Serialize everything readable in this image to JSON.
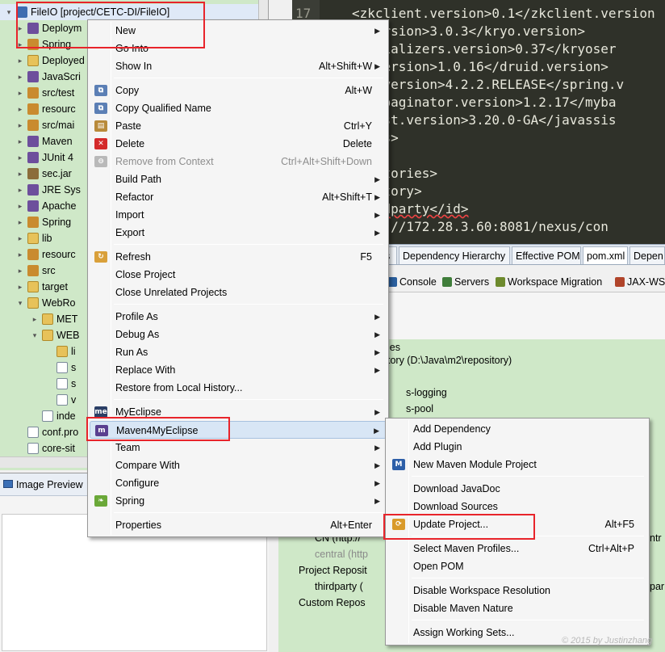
{
  "explorer": {
    "rows": [
      {
        "label": "FileIO [project/CETC-DI/FileIO]",
        "icon": "project-icon",
        "kind": "project",
        "arrow": "▾"
      },
      {
        "label": "Deploym",
        "icon": "deployment-icon",
        "kind": "lib",
        "arrow": "▸"
      },
      {
        "label": "Spring",
        "icon": "spring-icon",
        "kind": "src",
        "arrow": "▸"
      },
      {
        "label": "Deployed",
        "icon": "deployed-icon",
        "kind": "folder",
        "arrow": "▸"
      },
      {
        "label": "JavaScri",
        "icon": "library-icon",
        "kind": "lib",
        "arrow": "▸"
      },
      {
        "label": "src/test",
        "icon": "source-folder-icon",
        "kind": "src",
        "arrow": "▸"
      },
      {
        "label": "resourc",
        "icon": "source-folder-icon",
        "kind": "src",
        "arrow": "▸"
      },
      {
        "label": "src/mai",
        "icon": "source-folder-icon",
        "kind": "src",
        "arrow": "▸"
      },
      {
        "label": "Maven",
        "icon": "library-icon",
        "kind": "lib",
        "arrow": "▸"
      },
      {
        "label": "JUnit 4",
        "icon": "library-icon",
        "kind": "lib",
        "arrow": "▸"
      },
      {
        "label": "sec.jar",
        "icon": "jar-icon",
        "kind": "jar",
        "arrow": "▸"
      },
      {
        "label": "JRE Sys",
        "icon": "library-icon",
        "kind": "lib",
        "arrow": "▸"
      },
      {
        "label": "Apache",
        "icon": "library-icon",
        "kind": "lib",
        "arrow": "▸"
      },
      {
        "label": "Spring",
        "icon": "spring-icon",
        "kind": "src",
        "arrow": "▸"
      },
      {
        "label": "lib",
        "icon": "folder-icon",
        "kind": "folder",
        "arrow": "▸"
      },
      {
        "label": "resourc",
        "icon": "source-folder-icon",
        "kind": "src",
        "arrow": "▸"
      },
      {
        "label": "src",
        "icon": "source-folder-icon",
        "kind": "src",
        "arrow": "▸"
      },
      {
        "label": "target",
        "icon": "folder-icon",
        "kind": "folder",
        "arrow": "▸"
      },
      {
        "label": "WebRo",
        "icon": "folder-icon",
        "kind": "folder",
        "arrow": "▾"
      },
      {
        "label": "MET",
        "icon": "folder-icon",
        "kind": "folder",
        "arrow": "▸"
      },
      {
        "label": "WEB",
        "icon": "folder-icon",
        "kind": "folder",
        "arrow": "▾"
      },
      {
        "label": "li",
        "icon": "folder-icon",
        "kind": "folder",
        "arrow": ""
      },
      {
        "label": "s",
        "icon": "file-icon",
        "kind": "file",
        "arrow": ""
      },
      {
        "label": "s",
        "icon": "file-icon",
        "kind": "file",
        "arrow": ""
      },
      {
        "label": "v",
        "icon": "file-icon",
        "kind": "file",
        "arrow": ""
      },
      {
        "label": "inde",
        "icon": "file-icon",
        "kind": "file",
        "arrow": ""
      },
      {
        "label": "conf.pro",
        "icon": "file-icon",
        "kind": "file",
        "arrow": ""
      },
      {
        "label": "core-sit",
        "icon": "file-icon",
        "kind": "file",
        "arrow": ""
      }
    ]
  },
  "preview": {
    "title": "Image Preview"
  },
  "editor": {
    "line_number": "17",
    "lines": [
      "<zkclient.version>0.1</zkclient.version",
      "o.version>3.0.3</kryo.version>",
      "oserializers.version>0.37</kryoser",
      "id.version>1.0.16</druid.version>",
      "ing.version>4.2.2.RELEASE</spring.v",
      "atispaginator.version>1.2.17</myba",
      "assist.version>3.20.0-GA</javassis",
      "rties>",
      "",
      "positories>",
      "pository>",
      "thirdparty</id>",
      "http://172.28.3.60:8081/nexus/con"
    ]
  },
  "editor_tabs": [
    "s",
    "Dependency Hierarchy",
    "Effective POM",
    "pom.xml",
    "Depen"
  ],
  "console_tabs": [
    {
      "label": "Console",
      "icon": "console-icon"
    },
    {
      "label": "Servers",
      "icon": "servers-icon"
    },
    {
      "label": "Workspace Migration",
      "icon": "migration-icon"
    },
    {
      "label": "JAX-WS",
      "icon": "jaxws-icon"
    }
  ],
  "repo_view": {
    "rows": [
      {
        "label": "ies",
        "dim": false
      },
      {
        "label": "tory (D:\\Java\\m2\\repository)",
        "dim": false
      },
      {
        "label": "s-logging",
        "dim": false
      },
      {
        "label": "s-pool",
        "dim": false
      },
      {
        "label": "CN (http://",
        "dim": false
      },
      {
        "label": "central (http",
        "dim": true
      },
      {
        "label": "Project Reposit",
        "dim": false
      },
      {
        "label": "thirdparty (",
        "dim": false
      },
      {
        "label": "Custom Repos",
        "dim": false
      },
      {
        "label": "ntr",
        "dim": false
      },
      {
        "label": "par",
        "dim": false
      }
    ]
  },
  "context_menu": {
    "items": [
      {
        "label": "New",
        "shortcut": "",
        "submenu": true,
        "icon": ""
      },
      {
        "label": "Go Into",
        "shortcut": "",
        "submenu": false,
        "icon": ""
      },
      {
        "label": "Show In",
        "shortcut": "Alt+Shift+W",
        "submenu": true,
        "icon": ""
      },
      {
        "sep": true
      },
      {
        "label": "Copy",
        "shortcut": "Alt+W",
        "submenu": false,
        "icon": "copy-icon"
      },
      {
        "label": "Copy Qualified Name",
        "shortcut": "",
        "submenu": false,
        "icon": "copy-qualified-icon"
      },
      {
        "label": "Paste",
        "shortcut": "Ctrl+Y",
        "submenu": false,
        "icon": "paste-icon"
      },
      {
        "label": "Delete",
        "shortcut": "Delete",
        "submenu": false,
        "icon": "delete-icon"
      },
      {
        "label": "Remove from Context",
        "shortcut": "Ctrl+Alt+Shift+Down",
        "submenu": false,
        "icon": "remove-context-icon",
        "disabled": true
      },
      {
        "label": "Build Path",
        "shortcut": "",
        "submenu": true,
        "icon": ""
      },
      {
        "label": "Refactor",
        "shortcut": "Alt+Shift+T",
        "submenu": true,
        "icon": ""
      },
      {
        "label": "Import",
        "shortcut": "",
        "submenu": true,
        "icon": ""
      },
      {
        "label": "Export",
        "shortcut": "",
        "submenu": true,
        "icon": ""
      },
      {
        "sep": true
      },
      {
        "label": "Refresh",
        "shortcut": "F5",
        "submenu": false,
        "icon": "refresh-icon"
      },
      {
        "label": "Close Project",
        "shortcut": "",
        "submenu": false,
        "icon": ""
      },
      {
        "label": "Close Unrelated Projects",
        "shortcut": "",
        "submenu": false,
        "icon": ""
      },
      {
        "sep": true
      },
      {
        "label": "Profile As",
        "shortcut": "",
        "submenu": true,
        "icon": ""
      },
      {
        "label": "Debug As",
        "shortcut": "",
        "submenu": true,
        "icon": ""
      },
      {
        "label": "Run As",
        "shortcut": "",
        "submenu": true,
        "icon": ""
      },
      {
        "label": "Replace With",
        "shortcut": "",
        "submenu": true,
        "icon": ""
      },
      {
        "label": "Restore from Local History...",
        "shortcut": "",
        "submenu": false,
        "icon": ""
      },
      {
        "sep": true
      },
      {
        "label": "MyEclipse",
        "shortcut": "",
        "submenu": true,
        "icon": "myeclipse-icon"
      },
      {
        "label": "Maven4MyEclipse",
        "shortcut": "",
        "submenu": true,
        "icon": "maven4myeclipse-icon",
        "hover": true
      },
      {
        "label": "Team",
        "shortcut": "",
        "submenu": true,
        "icon": ""
      },
      {
        "label": "Compare With",
        "shortcut": "",
        "submenu": true,
        "icon": ""
      },
      {
        "label": "Configure",
        "shortcut": "",
        "submenu": true,
        "icon": ""
      },
      {
        "label": "Spring",
        "shortcut": "",
        "submenu": true,
        "icon": "spring-leaf-icon"
      },
      {
        "sep": true
      },
      {
        "label": "Properties",
        "shortcut": "Alt+Enter",
        "submenu": false,
        "icon": ""
      }
    ]
  },
  "maven_submenu": {
    "items": [
      {
        "label": "Add Dependency",
        "shortcut": "",
        "icon": ""
      },
      {
        "label": "Add Plugin",
        "shortcut": "",
        "icon": ""
      },
      {
        "label": "New Maven Module Project",
        "shortcut": "",
        "icon": "maven-module-icon"
      },
      {
        "sep": true
      },
      {
        "label": "Download JavaDoc",
        "shortcut": "",
        "icon": ""
      },
      {
        "label": "Download Sources",
        "shortcut": "",
        "icon": ""
      },
      {
        "label": "Update Project...",
        "shortcut": "Alt+F5",
        "icon": "update-project-icon"
      },
      {
        "sep": true
      },
      {
        "label": "Select Maven Profiles...",
        "shortcut": "Ctrl+Alt+P",
        "icon": ""
      },
      {
        "label": "Open POM",
        "shortcut": "",
        "icon": ""
      },
      {
        "sep": true
      },
      {
        "label": "Disable Workspace Resolution",
        "shortcut": "",
        "icon": ""
      },
      {
        "label": "Disable Maven Nature",
        "shortcut": "",
        "icon": ""
      },
      {
        "sep": true
      },
      {
        "label": "Assign Working Sets...",
        "shortcut": "",
        "icon": ""
      }
    ]
  },
  "watermark": "© 2015  by  Justinzhang",
  "colors": {
    "highlight": "#e8242b",
    "hover": "#d8e6f5",
    "tree_bg": "#cfe8c8",
    "editor_bg": "#2f3129"
  }
}
